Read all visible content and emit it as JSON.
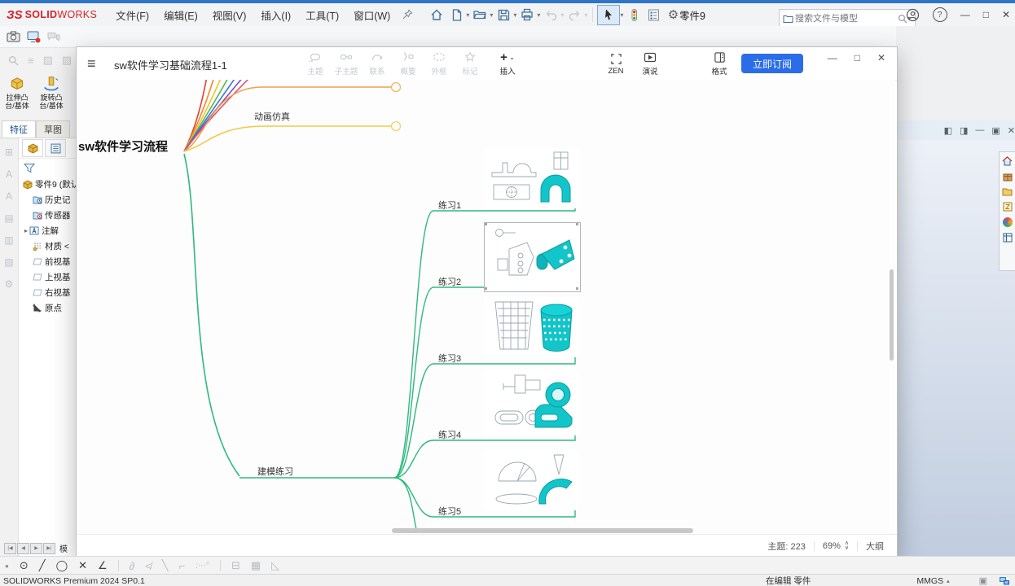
{
  "titlebar": {
    "logo_mark": "ЗS",
    "logo_bold": "SOLID",
    "logo_light": "WORKS",
    "menus": [
      "文件(F)",
      "编辑(E)",
      "视图(V)",
      "插入(I)",
      "工具(T)",
      "窗口(W)"
    ],
    "doc_title": "零件9",
    "search_placeholder": "搜索文件与模型",
    "help": "?",
    "min": "—",
    "max": "□",
    "close": "✕"
  },
  "left_panel": {
    "cmd1_line1": "拉伸凸",
    "cmd1_line2": "台/基体",
    "cmd2_line1": "旋转凸",
    "cmd2_line2": "台/基体",
    "tab_features": "特征",
    "tab_sketch": "草图",
    "tree": [
      "零件9 (默认",
      "历史记",
      "传感器",
      "注解",
      "材质 <",
      "前视基",
      "上视基",
      "右视基",
      "原点"
    ],
    "model_tab": "模"
  },
  "mindmap": {
    "title": "sw软件学习基础流程1-1",
    "tools": [
      "主题",
      "子主题",
      "联系",
      "概要",
      "外框",
      "标记",
      "插入"
    ],
    "zen": "ZEN",
    "present": "演说",
    "format": "格式",
    "subscribe": "立即订阅",
    "min": "—",
    "max": "□",
    "close": "✕",
    "root": "sw软件学习流程",
    "animation": "动画仿真",
    "modeling": "建模练习",
    "practices": [
      "练习1",
      "练习2",
      "练习3",
      "练习4",
      "练习5"
    ],
    "topics": "主题: 223",
    "zoom": "69%",
    "outline": "大纲"
  },
  "bottom": {
    "status_left": "SOLIDWORKS Premium 2024 SP0.1",
    "editing": "在编辑 零件",
    "units": "MMGS"
  },
  "colors": {
    "accent_blue": "#2b6de8",
    "model_teal": "#10c2c6",
    "branch_green": "#2eb980",
    "branch_orange": "#f0a24a",
    "branch_yellow": "#f2c94c",
    "sw_red": "#d8232a"
  }
}
